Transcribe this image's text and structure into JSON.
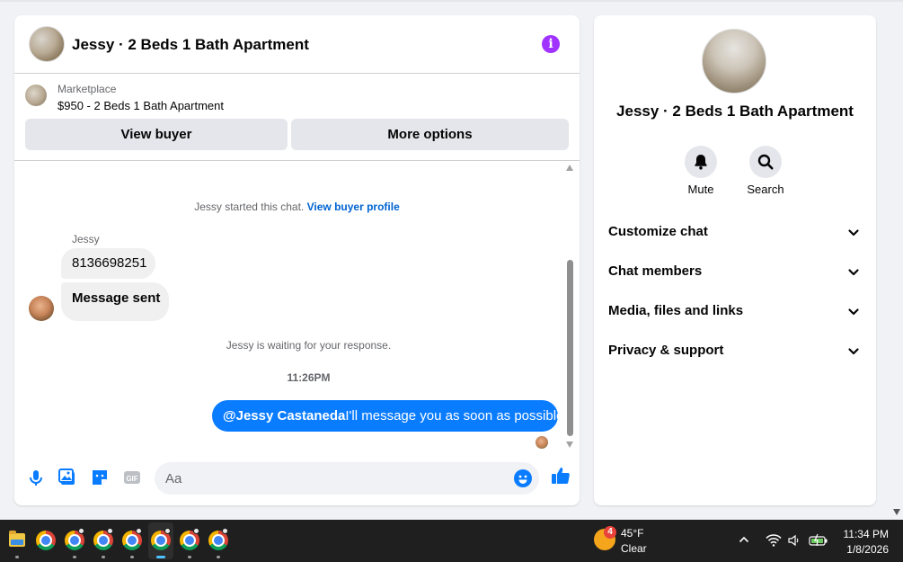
{
  "chat": {
    "title": "Jessy · 2 Beds 1 Bath Apartment",
    "listing": {
      "source": "Marketplace",
      "price_title": "$950 - 2 Beds 1 Bath Apartment"
    },
    "buttons": {
      "view_buyer": "View buyer",
      "more_options": "More options"
    },
    "messages": {
      "started_text": "Jessy started this chat.",
      "started_link": "View buyer profile",
      "sender_name": "Jessy",
      "incoming": [
        "8136698251",
        "Message sent"
      ],
      "waiting_text": "Jessy is waiting for your response.",
      "timestamp": "11:26PM",
      "outgoing_mention": "@Jessy Castaneda",
      "outgoing_text": "I'll message you as soon as possible"
    },
    "composer": {
      "placeholder": "Aa",
      "value": ""
    }
  },
  "info": {
    "title": "Jessy · 2 Beds 1 Bath Apartment",
    "actions": [
      {
        "label": "Mute",
        "icon": "bell-icon"
      },
      {
        "label": "Search",
        "icon": "search-icon"
      }
    ],
    "sections": [
      "Customize chat",
      "Chat members",
      "Media, files and links",
      "Privacy & support"
    ]
  },
  "taskbar": {
    "weather": {
      "badge": "4",
      "temp": "45°F",
      "condition": "Clear"
    },
    "clock": {
      "time": "11:34 PM",
      "date": "1/8/2026"
    }
  },
  "colors": {
    "accent": "#0a7cff",
    "info_icon": "#a033ff",
    "link": "#0064d1"
  }
}
